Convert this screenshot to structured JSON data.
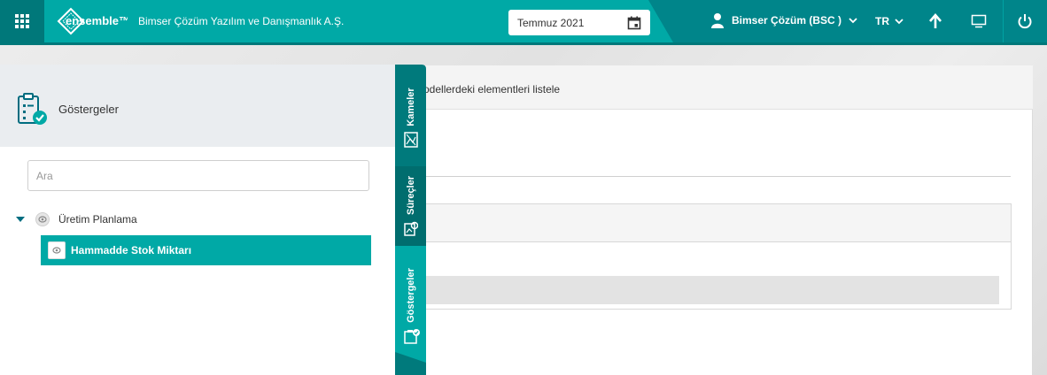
{
  "header": {
    "logo_text": "ensemble™",
    "company": "Bimser Çözüm Yazılım ve Danışmanlık A.Ş.",
    "date_value": "Temmuz 2021",
    "user_name": "Bimser Çözüm (BSC )",
    "language": "TR",
    "icons": [
      "apps-grid-icon",
      "calendar-icon",
      "user-icon",
      "chevron-down-icon",
      "arrow-up-icon",
      "monitor-icon",
      "power-icon"
    ]
  },
  "panel": {
    "title": "Göstergeler",
    "search_placeholder": "Ara",
    "tree": {
      "parent_label": "Üretim Planlama",
      "child_label": "Hammadde Stok Miktarı"
    }
  },
  "tabs": [
    {
      "label": "Kameler"
    },
    {
      "label": "Süreçler"
    },
    {
      "label": "Göstergeler"
    }
  ],
  "main": {
    "toolbar_text": "odellerdeki elementleri listele"
  },
  "colors": {
    "primary": "#00a9a6",
    "primary_dark": "#00858a",
    "tab_dark": "#006d6e"
  }
}
